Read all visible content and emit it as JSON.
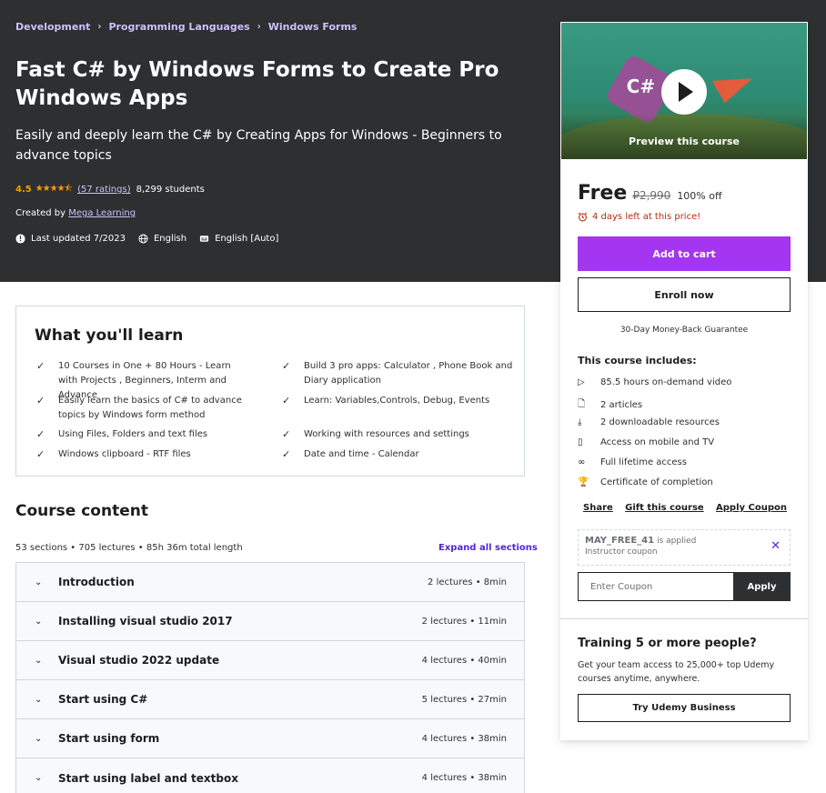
{
  "breadcrumb": [
    "Development",
    "Programming Languages",
    "Windows Forms"
  ],
  "header": {
    "title": "Fast C# by Windows Forms to Create Pro Windows Apps",
    "subtitle": "Easily and deeply learn the C# by Creating Apps for Windows - Beginners to advance topics",
    "rating": "4.5",
    "stars": "★★★★⯪",
    "ratings_count": "(57 ratings)",
    "students": "8,299 students",
    "created_by_label": "Created by",
    "author": "Mega Learning",
    "last_updated": "Last updated 7/2023",
    "language": "English",
    "captions": "English [Auto]"
  },
  "learn": {
    "title": "What you'll learn",
    "items": [
      "10 Courses in One + 80 Hours - Learn with Projects , Beginners, Interm and Advance",
      "Build 3 pro apps: Calculator , Phone Book and Diary application",
      "Easily learn the basics of C# to advance topics by Windows form method",
      "Learn: Variables,Controls, Debug, Events",
      "Using Files, Folders and text files",
      "Working with resources and settings",
      "Windows clipboard - RTF files",
      "Date and time - Calendar"
    ]
  },
  "content": {
    "title": "Course content",
    "meta": "53 sections • 705 lectures • 85h 36m total length",
    "expand_all": "Expand all sections",
    "sections": [
      {
        "name": "Introduction",
        "info": "2 lectures • 8min"
      },
      {
        "name": "Installing visual studio 2017",
        "info": "2 lectures • 11min"
      },
      {
        "name": "Visual studio 2022 update",
        "info": "4 lectures • 40min"
      },
      {
        "name": "Start using C#",
        "info": "5 lectures • 27min"
      },
      {
        "name": "Start using form",
        "info": "4 lectures • 38min"
      },
      {
        "name": "Start using label and textbox",
        "info": "4 lectures • 38min"
      }
    ]
  },
  "sidebar": {
    "preview_label": "Preview this course",
    "price": "Free",
    "old_price": "₽2,990",
    "discount": "100% off",
    "timer": "4 days left at this price!",
    "add_to_cart": "Add to cart",
    "enroll": "Enroll now",
    "guarantee": "30-Day Money-Back Guarantee",
    "includes_title": "This course includes:",
    "includes": [
      {
        "icon": "video-icon",
        "glyph": "▷",
        "text": "85.5 hours on-demand video"
      },
      {
        "icon": "article-icon",
        "glyph": "🗋",
        "text": "2 articles"
      },
      {
        "icon": "download-icon",
        "glyph": "⤓",
        "text": "2 downloadable resources"
      },
      {
        "icon": "mobile-icon",
        "glyph": "▯",
        "text": "Access on mobile and TV"
      },
      {
        "icon": "infinity-icon",
        "glyph": "∞",
        "text": "Full lifetime access"
      },
      {
        "icon": "trophy-icon",
        "glyph": "🏆",
        "text": "Certificate of completion"
      }
    ],
    "share": "Share",
    "gift": "Gift this course",
    "apply_coupon": "Apply Coupon",
    "coupon_code": "MAY_FREE_41",
    "coupon_applied": "is applied",
    "coupon_type": "Instructor coupon",
    "coupon_placeholder": "Enter Coupon",
    "coupon_apply_btn": "Apply",
    "team_title": "Training 5 or more people?",
    "team_text": "Get your team access to 25,000+ top Udemy courses anytime, anywhere.",
    "business_btn": "Try Udemy Business"
  },
  "colors": {
    "hero_bg": "#2d2f31",
    "accent_purple": "#a435f0",
    "link_purple": "#5624d0",
    "star_orange": "#f69c08",
    "timer_red": "#b32d0f"
  }
}
